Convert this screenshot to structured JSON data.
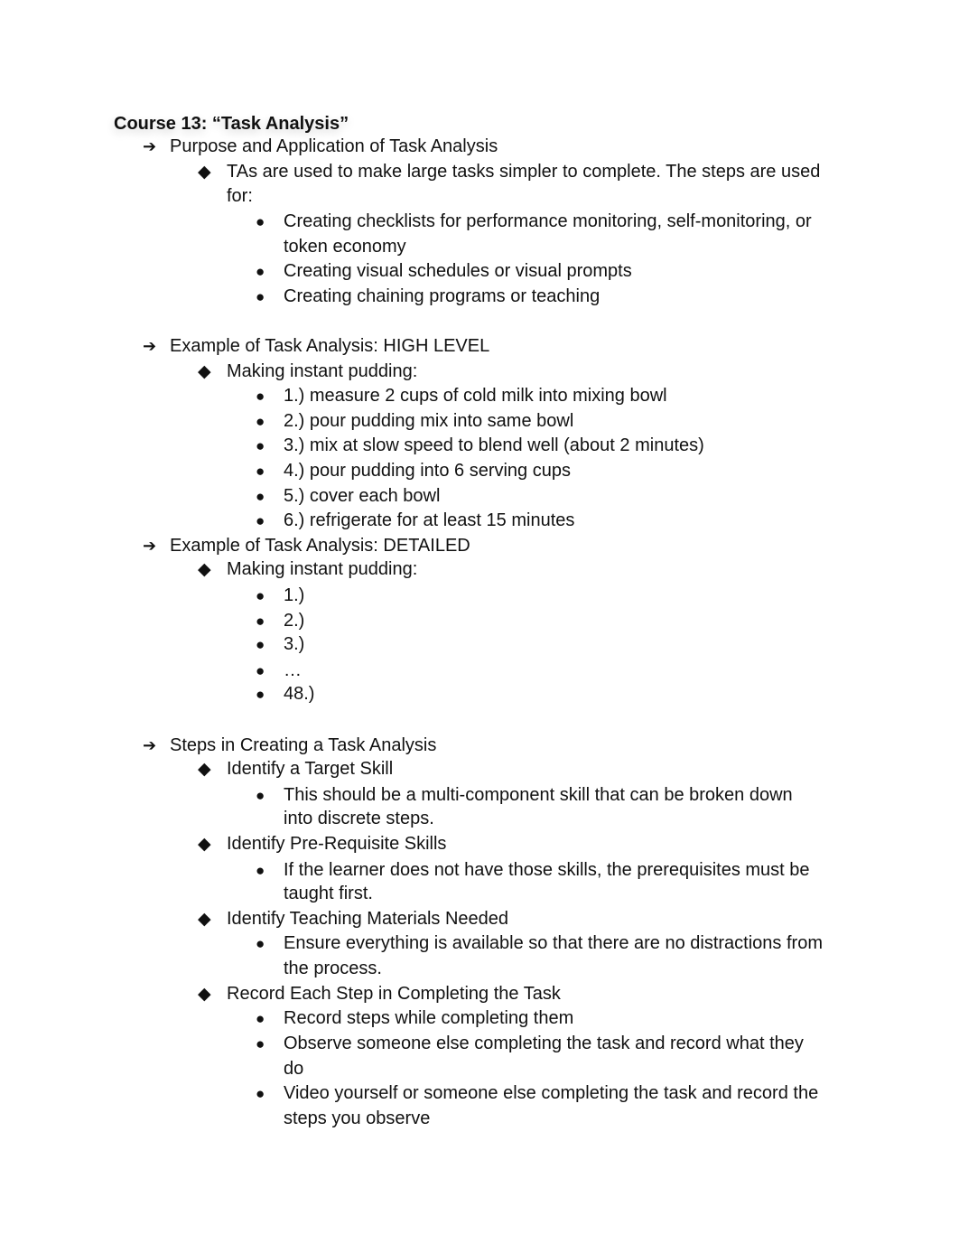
{
  "document": {
    "title": "Course 13: “Task Analysis”",
    "markers": {
      "level1": "➔",
      "level2": "◆",
      "level3": "●"
    },
    "sections": [
      {
        "heading": "Purpose and Application of Task Analysis",
        "items": [
          {
            "text_line1": "TAs are used to make large tasks simpler to complete. The steps are used",
            "text_line2": "for:",
            "subitems": [
              {
                "line1": "Creating checklists for performance monitoring, self-monitoring, or",
                "line2": "token economy"
              },
              {
                "line1": "Creating visual schedules or visual prompts"
              },
              {
                "line1": "Creating chaining programs or teaching"
              }
            ]
          }
        ]
      },
      {
        "heading": "Example of Task Analysis: HIGH LEVEL",
        "items": [
          {
            "text_line1": "Making instant pudding:",
            "subitems": [
              {
                "line1": "1.) measure 2 cups of cold milk into mixing bowl"
              },
              {
                "line1": "2.) pour pudding mix into same bowl"
              },
              {
                "line1": "3.) mix at slow speed to blend well (about 2 minutes)"
              },
              {
                "line1": "4.) pour pudding into 6 serving cups"
              },
              {
                "line1": "5.) cover each bowl"
              },
              {
                "line1": "6.) refrigerate for at least 15 minutes"
              }
            ]
          }
        ]
      },
      {
        "heading": "Example of Task Analysis: DETAILED",
        "items": [
          {
            "text_line1": "Making instant pudding:",
            "subitems": [
              {
                "line1": "1.)"
              },
              {
                "line1": "2.)"
              },
              {
                "line1": "3.)"
              },
              {
                "line1": "…"
              },
              {
                "line1": "48.)"
              }
            ]
          }
        ]
      },
      {
        "heading": "Steps in Creating a Task Analysis",
        "items": [
          {
            "text_line1": "Identify a Target Skill",
            "subitems": [
              {
                "line1": "This should be a multi-component skill that can be broken down",
                "line2": "into discrete steps."
              }
            ]
          },
          {
            "text_line1": "Identify Pre-Requisite Skills",
            "subitems": [
              {
                "line1": "If the learner does not have those skills, the prerequisites must be",
                "line2": "taught first."
              }
            ]
          },
          {
            "text_line1": "Identify Teaching Materials Needed",
            "subitems": [
              {
                "line1": "Ensure everything is available so that there are no distractions from",
                "line2": "the process."
              }
            ]
          },
          {
            "text_line1": "Record Each Step in Completing the Task",
            "subitems": [
              {
                "line1": "Record steps while completing them"
              },
              {
                "line1": "Observe someone else completing the task and record what they",
                "line2": "do"
              },
              {
                "line1": "Video yourself or someone else completing the task and record the",
                "line2": "steps you observe"
              }
            ]
          }
        ]
      }
    ]
  }
}
